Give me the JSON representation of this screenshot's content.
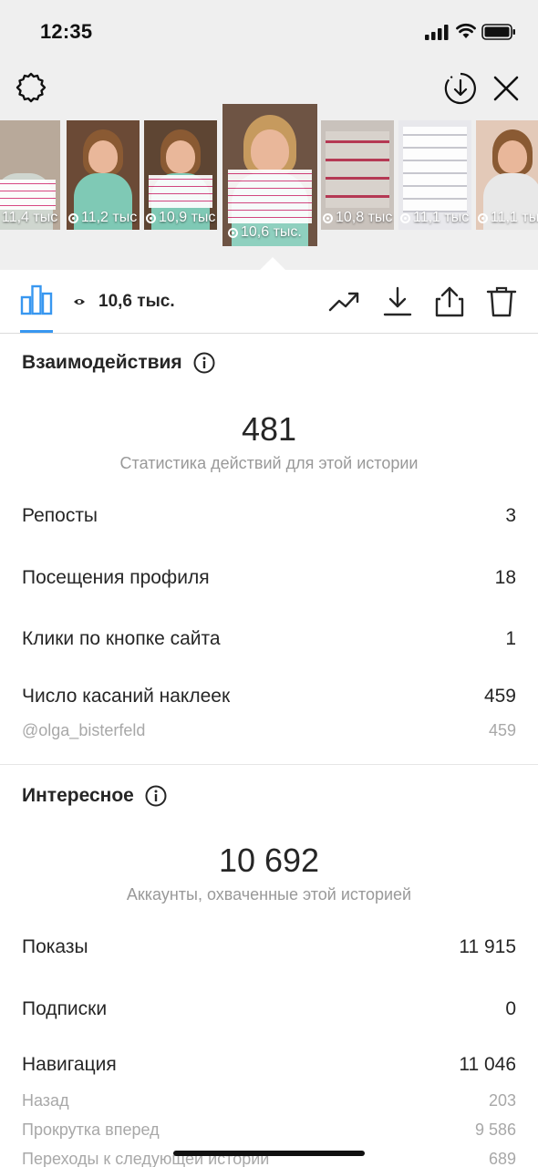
{
  "status": {
    "time": "12:35"
  },
  "thumbnails": [
    {
      "views": "11,4 тыс",
      "bg": "#b8a99a"
    },
    {
      "views": "11,2 тыс",
      "bg": "#6b4a36"
    },
    {
      "views": "10,9 тыс",
      "bg": "#5e4533"
    },
    {
      "views": "10,6 тыс.",
      "bg": "#6e5444",
      "selected": true
    },
    {
      "views": "10,8 тыс",
      "bg": "#c9c2bc"
    },
    {
      "views": "11,1 тыс",
      "bg": "#e8e8ec"
    },
    {
      "views": "11,1 тыс",
      "bg": "#e3c9b8"
    }
  ],
  "tabbar": {
    "views": "10,6 тыс."
  },
  "interactions": {
    "title": "Взаимодействия",
    "total": "481",
    "total_caption": "Статистика действий для этой истории",
    "rows": [
      {
        "label": "Репосты",
        "value": "3"
      },
      {
        "label": "Посещения профиля",
        "value": "18"
      },
      {
        "label": "Клики по кнопке сайта",
        "value": "1"
      },
      {
        "label": "Число касаний наклеек",
        "value": "459"
      }
    ],
    "sticker_row": {
      "label": "@olga_bisterfeld",
      "value": "459"
    }
  },
  "discovery": {
    "title": "Интересное",
    "total": "10 692",
    "total_caption": "Аккаунты, охваченные этой историей",
    "rows": [
      {
        "label": "Показы",
        "value": "11 915"
      },
      {
        "label": "Подписки",
        "value": "0"
      },
      {
        "label": "Навигация",
        "value": "11 046"
      }
    ],
    "nav_rows": [
      {
        "label": "Назад",
        "value": "203"
      },
      {
        "label": "Прокрутка вперед",
        "value": "9 586"
      },
      {
        "label": "Переходы к следующей истории",
        "value": "689"
      }
    ]
  },
  "colors": {
    "accent": "#3897f0",
    "muted": "#999999"
  }
}
